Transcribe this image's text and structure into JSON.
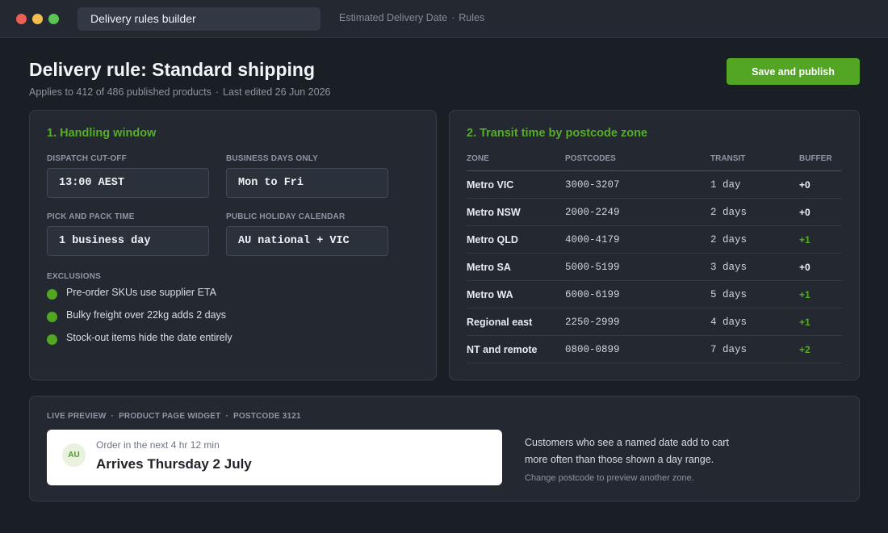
{
  "window": {
    "address_bar": "Delivery rules builder",
    "breadcrumb": [
      "Estimated Delivery Date",
      "Rules"
    ],
    "breadcrumb_separator": "·"
  },
  "header": {
    "title": "Delivery rule: Standard shipping",
    "applies_to": "Applies to 412 of 486 published products",
    "last_edited": "Last edited 26 Jun 2026",
    "separator": "·",
    "save_label": "Save and publish"
  },
  "handling": {
    "heading": "1. Handling window",
    "fields": [
      {
        "label": "DISPATCH CUT-OFF",
        "value": "13:00 AEST"
      },
      {
        "label": "BUSINESS DAYS ONLY",
        "value": "Mon to Fri"
      },
      {
        "label": "PICK AND PACK TIME",
        "value": "1 business day"
      },
      {
        "label": "PUBLIC HOLIDAY CALENDAR",
        "value": "AU national + VIC"
      }
    ],
    "exclusions_label": "EXCLUSIONS",
    "exclusions": [
      "Pre-order SKUs use supplier ETA",
      "Bulky freight over 22kg adds 2 days",
      "Stock-out items hide the date entirely"
    ]
  },
  "transit": {
    "heading": "2. Transit time by postcode zone",
    "columns": [
      "ZONE",
      "POSTCODES",
      "TRANSIT",
      "BUFFER"
    ],
    "rows": [
      {
        "zone": "Metro VIC",
        "postcodes": "3000-3207",
        "transit": "1 day",
        "buffer": "+0"
      },
      {
        "zone": "Metro NSW",
        "postcodes": "2000-2249",
        "transit": "2 days",
        "buffer": "+0"
      },
      {
        "zone": "Metro QLD",
        "postcodes": "4000-4179",
        "transit": "2 days",
        "buffer": "+1"
      },
      {
        "zone": "Metro SA",
        "postcodes": "5000-5199",
        "transit": "3 days",
        "buffer": "+0"
      },
      {
        "zone": "Metro WA",
        "postcodes": "6000-6199",
        "transit": "5 days",
        "buffer": "+1"
      },
      {
        "zone": "Regional east",
        "postcodes": "2250-2999",
        "transit": "4 days",
        "buffer": "+1"
      },
      {
        "zone": "NT and remote",
        "postcodes": "0800-0899",
        "transit": "7 days",
        "buffer": "+2"
      }
    ]
  },
  "preview": {
    "label_parts": [
      "LIVE PREVIEW",
      "PRODUCT PAGE WIDGET",
      "POSTCODE 3121"
    ],
    "separator": "·",
    "badge": "AU",
    "countdown": "Order in the next 4 hr 12 min",
    "arrives": "Arrives Thursday 2 July",
    "note_line1": "Customers who see a named date add to cart",
    "note_line2": "more often than those shown a day range.",
    "hint": "Change postcode to preview another zone."
  },
  "colors": {
    "accent": "#52a624",
    "background": "#1a1e25",
    "panel": "#232831"
  }
}
